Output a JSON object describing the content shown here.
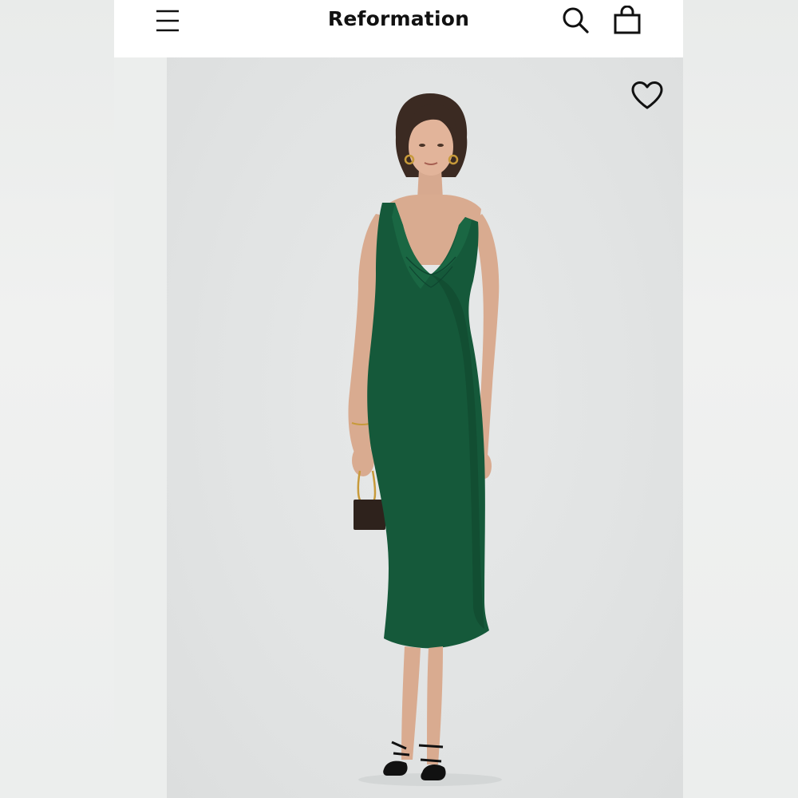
{
  "header": {
    "brand": "Reformation",
    "menu_icon": "hamburger-menu-icon",
    "search_icon": "search-icon",
    "bag_icon": "shopping-bag-icon"
  },
  "product_gallery": {
    "favorite_icon": "heart-outline-icon",
    "image_description_colors": {
      "dress": "#15593a",
      "backdrop": "#e2e4e4"
    }
  }
}
